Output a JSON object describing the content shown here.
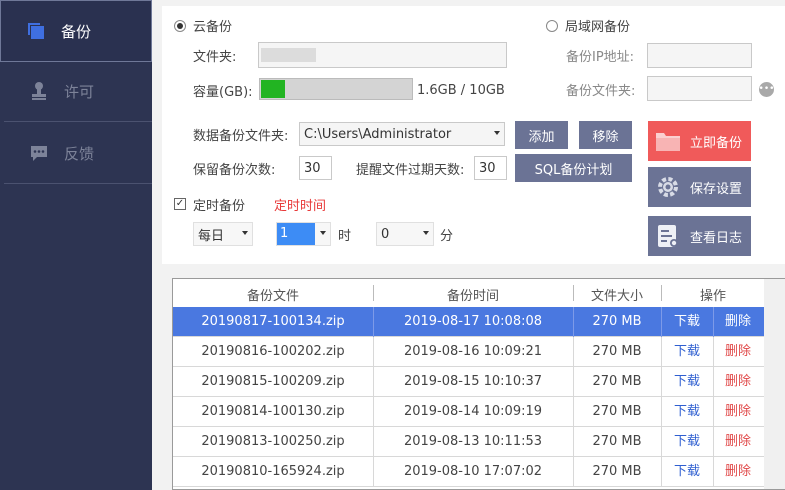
{
  "sidebar": {
    "items": [
      {
        "label": "备份",
        "icon": "backup-icon",
        "active": true
      },
      {
        "label": "许可",
        "icon": "license-stamp-icon",
        "active": false
      },
      {
        "label": "反馈",
        "icon": "feedback-chat-icon",
        "active": false
      }
    ]
  },
  "cloud": {
    "radio_label": "云备份",
    "folder_label": "文件夹:",
    "capacity_label": "容量(GB):",
    "capacity_text": "1.6GB / 10GB",
    "capacity_fraction": 0.16
  },
  "lan": {
    "radio_label": "局域网备份",
    "ip_label": "备份IP地址:",
    "folder_label": "备份文件夹:"
  },
  "form": {
    "data_folder_label": "数据备份文件夹:",
    "data_folder_value": "C:\\Users\\Administrator",
    "add_label": "添加",
    "remove_label": "移除",
    "keep_label": "保留备份次数:",
    "keep_value": "30",
    "remind_label": "提醒文件过期天数:",
    "remind_value": "30",
    "sql_plan_label": "SQL备份计划",
    "timed_label": "定时备份",
    "timed_hint": "定时时间",
    "freq_value": "每日",
    "hour_value": "1",
    "hour_unit": "时",
    "minute_value": "0",
    "minute_unit": "分"
  },
  "actions": {
    "backup_now": "立即备份",
    "save_settings": "保存设置",
    "view_log": "查看日志"
  },
  "colors": {
    "sidebar_bg": "#2d3452",
    "button_gray": "#6b7395",
    "backup_now_red": "#f05a5a",
    "selected_row": "#4a78e0",
    "progress_green": "#22b422"
  },
  "table": {
    "headers": [
      "备份文件",
      "备份时间",
      "文件大小",
      "操作"
    ],
    "rows": [
      {
        "file": "20190817-100134.zip",
        "time": "2019-08-17 10:08:08",
        "size": "270 MB",
        "download": "下载",
        "delete": "删除"
      },
      {
        "file": "20190816-100202.zip",
        "time": "2019-08-16 10:09:21",
        "size": "270 MB",
        "download": "下载",
        "delete": "删除"
      },
      {
        "file": "20190815-100209.zip",
        "time": "2019-08-15 10:10:37",
        "size": "270 MB",
        "download": "下载",
        "delete": "删除"
      },
      {
        "file": "20190814-100130.zip",
        "time": "2019-08-14 10:09:19",
        "size": "270 MB",
        "download": "下载",
        "delete": "删除"
      },
      {
        "file": "20190813-100250.zip",
        "time": "2019-08-13 10:11:53",
        "size": "270 MB",
        "download": "下载",
        "delete": "删除"
      },
      {
        "file": "20190810-165924.zip",
        "time": "2019-08-10 17:07:02",
        "size": "270 MB",
        "download": "下载",
        "delete": "删除"
      }
    ]
  }
}
